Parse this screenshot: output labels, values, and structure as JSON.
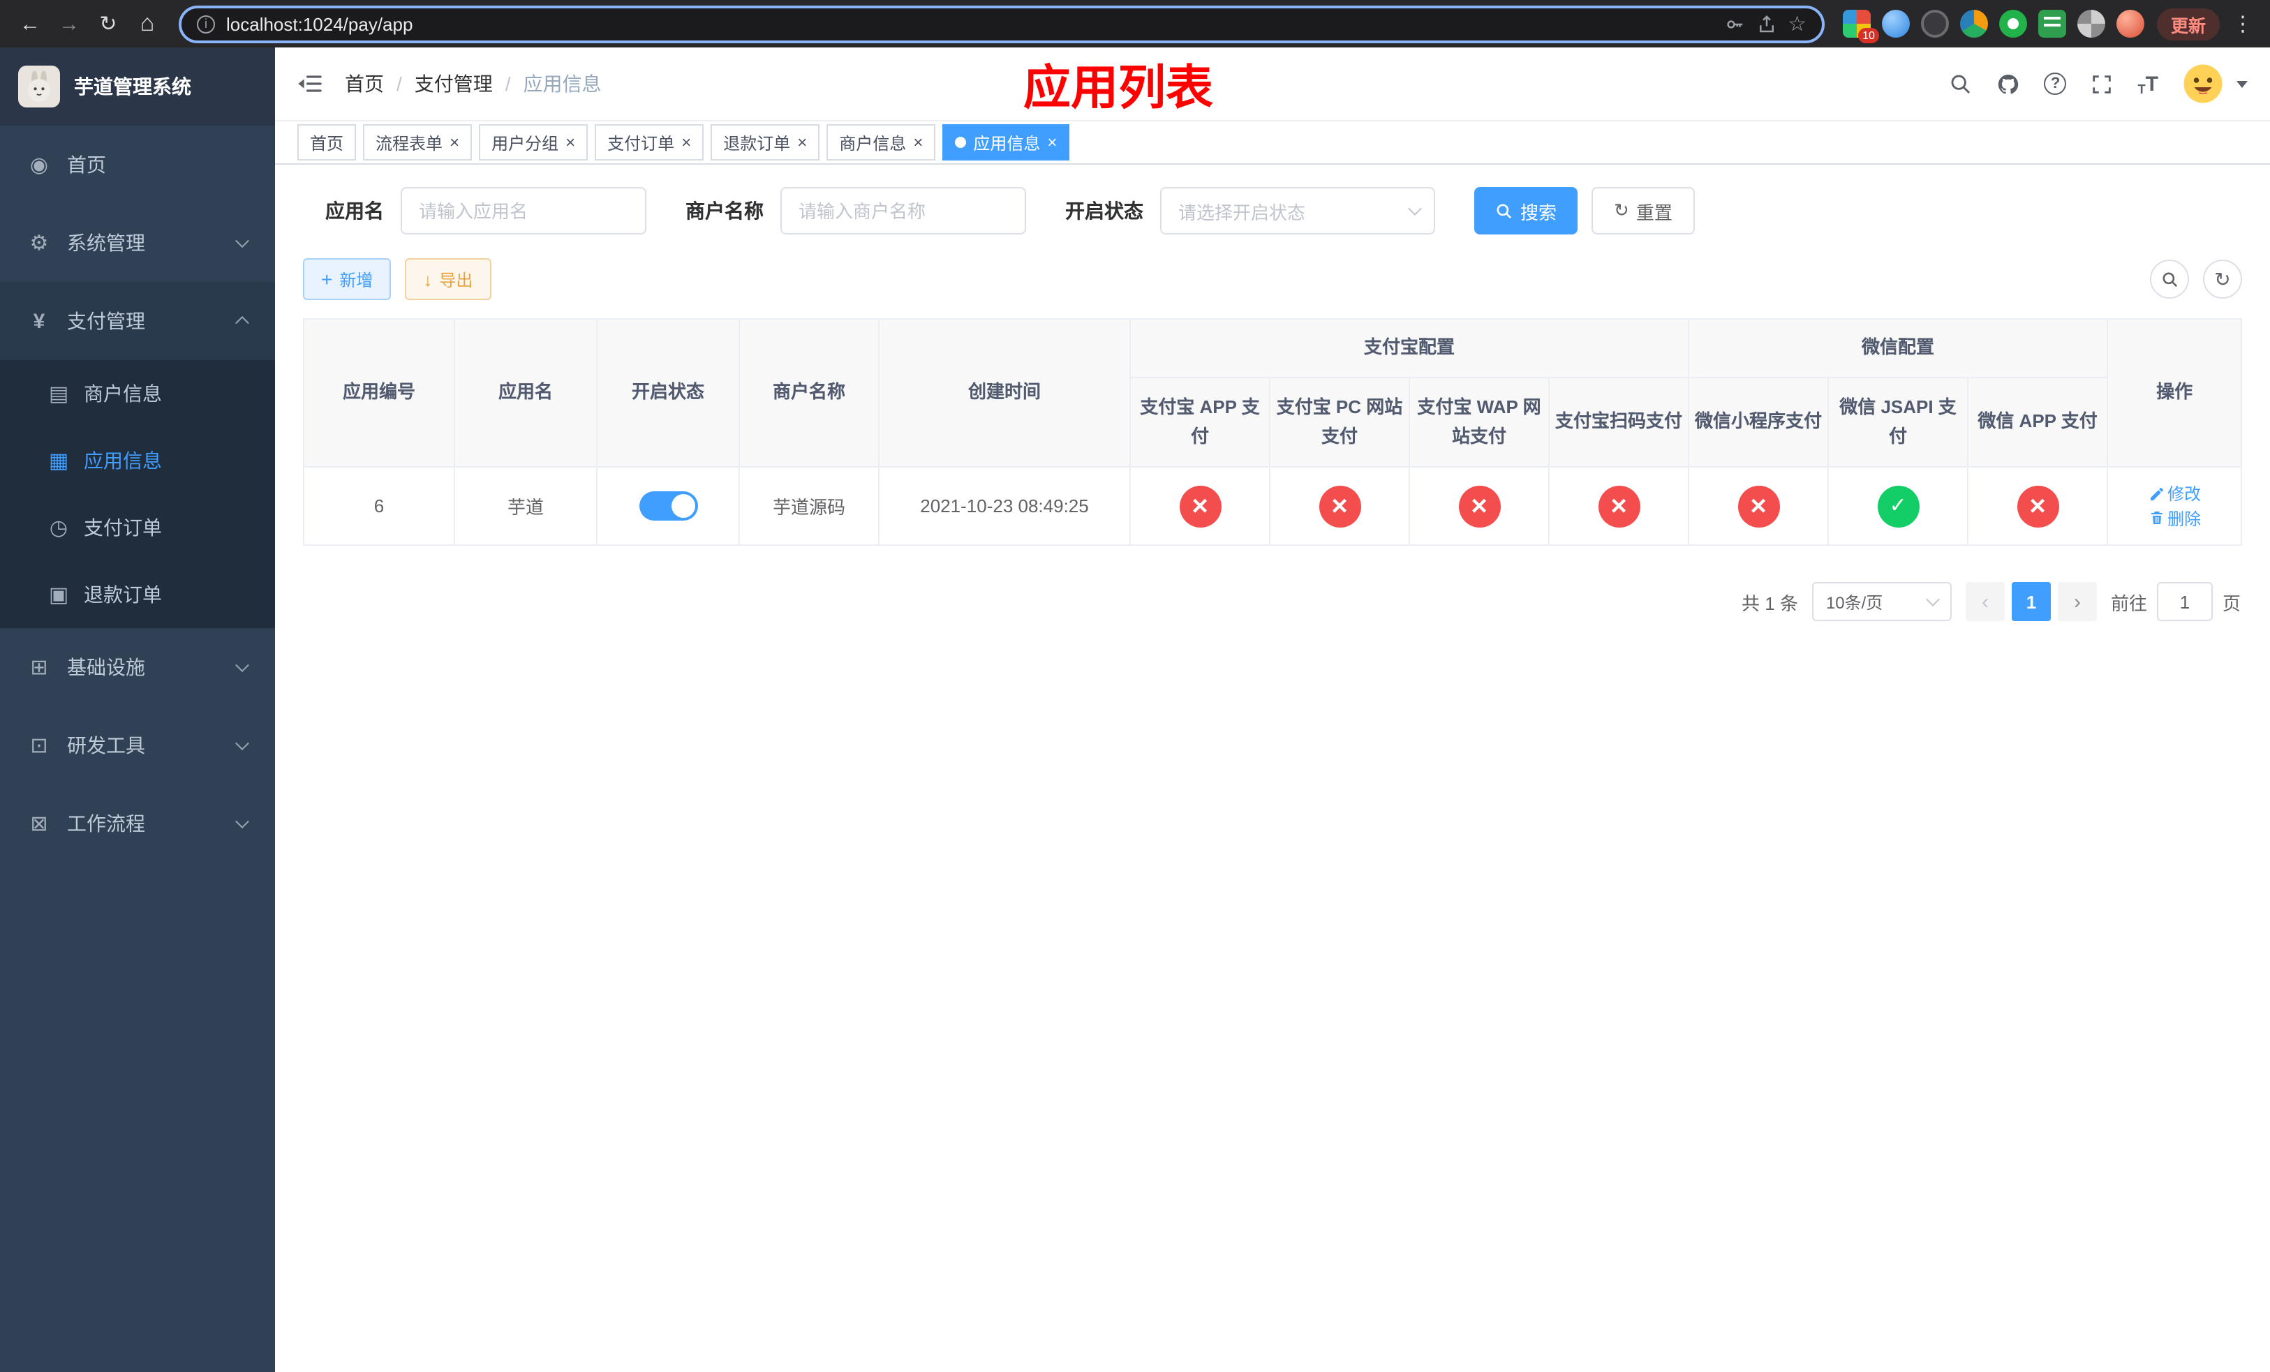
{
  "browser": {
    "url": "localhost:1024/pay/app",
    "update_button": "更新",
    "extension_badge": "10"
  },
  "colors": {
    "accent_blue": "#409EFF",
    "danger_red": "#f34d4d",
    "success_green": "#13ce66",
    "title_red": "#ff0000",
    "sidebar_bg": "#304156",
    "sidebar_submenu_bg": "#1f2d3d"
  },
  "icons": [
    "back-icon",
    "forward-icon",
    "reload-icon",
    "home-icon",
    "site-info-icon",
    "key-icon",
    "share-icon",
    "bookmark-star-icon",
    "browser-menu-icon",
    "hamburger-icon",
    "search-icon",
    "github-icon",
    "help-icon",
    "fullscreen-icon",
    "font-size-icon",
    "avatar",
    "dashboard-icon",
    "gear-icon",
    "yen-icon",
    "card-icon",
    "grid-icon",
    "clock-icon",
    "doc-icon",
    "infra-icon",
    "tool-icon",
    "flow-icon",
    "plus-icon",
    "download-icon",
    "refresh-icon",
    "edit-icon",
    "delete-icon",
    "check-icon",
    "close-icon"
  ],
  "sidebar": {
    "app_title": "芋道管理系统",
    "items": {
      "home": "首页",
      "system": "系统管理",
      "payment": "支付管理",
      "merchant": "商户信息",
      "app": "应用信息",
      "pay_order": "支付订单",
      "refund_order": "退款订单",
      "infra": "基础设施",
      "dev_tools": "研发工具",
      "workflow": "工作流程"
    }
  },
  "navbar": {
    "breadcrumb": {
      "home": "首页",
      "level1": "支付管理",
      "level2": "应用信息"
    },
    "page_title": "应用列表"
  },
  "tabs": [
    {
      "label": "首页",
      "closable": false,
      "active": false
    },
    {
      "label": "流程表单",
      "closable": true,
      "active": false
    },
    {
      "label": "用户分组",
      "closable": true,
      "active": false
    },
    {
      "label": "支付订单",
      "closable": true,
      "active": false
    },
    {
      "label": "退款订单",
      "closable": true,
      "active": false
    },
    {
      "label": "商户信息",
      "closable": true,
      "active": false
    },
    {
      "label": "应用信息",
      "closable": true,
      "active": true
    }
  ],
  "filters": {
    "app_name": {
      "label": "应用名",
      "placeholder": "请输入应用名",
      "value": ""
    },
    "merchant_name": {
      "label": "商户名称",
      "placeholder": "请输入商户名称",
      "value": ""
    },
    "status": {
      "label": "开启状态",
      "placeholder": "请选择开启状态"
    },
    "search": "搜索",
    "reset": "重置"
  },
  "toolbar": {
    "add": "新增",
    "export": "导出"
  },
  "table": {
    "group_headers": {
      "alipay": "支付宝配置",
      "wechat": "微信配置"
    },
    "columns": {
      "app_id": "应用编号",
      "app_name": "应用名",
      "status": "开启状态",
      "merchant_name": "商户名称",
      "create_time": "创建时间",
      "alipay_app": "支付宝 APP 支付",
      "alipay_pc": "支付宝 PC 网站支付",
      "alipay_wap": "支付宝 WAP 网站支付",
      "alipay_qr": "支付宝扫码支付",
      "wx_lite": "微信小程序支付",
      "wx_jsapi": "微信 JSAPI 支付",
      "wx_app": "微信 APP 支付",
      "actions": "操作"
    },
    "rows": [
      {
        "app_id": "6",
        "app_name": "芋道",
        "status_on": true,
        "merchant_name": "芋道源码",
        "create_time": "2021-10-23 08:49:25",
        "alipay_app": "disabled",
        "alipay_pc": "disabled",
        "alipay_wap": "disabled",
        "alipay_qr": "disabled",
        "wx_lite": "disabled",
        "wx_jsapi": "enabled",
        "wx_app": "disabled",
        "edit": "修改",
        "delete": "删除"
      }
    ]
  },
  "pagination": {
    "total": "共 1 条",
    "page_size": "10条/页",
    "current_page": "1",
    "goto_prefix": "前往",
    "goto_value": "1",
    "goto_suffix": "页"
  }
}
